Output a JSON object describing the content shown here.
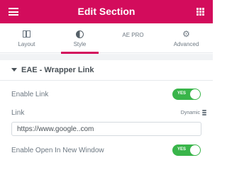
{
  "header": {
    "title": "Edit Section"
  },
  "tabs": [
    {
      "label": "Layout",
      "icon": "columns-icon"
    },
    {
      "label": "Style",
      "icon": "half-circle-icon",
      "active": true
    },
    {
      "label": "AE PRO"
    },
    {
      "label": "Advanced",
      "icon": "gear-icon"
    }
  ],
  "section": {
    "title": "EAE - Wrapper Link"
  },
  "controls": {
    "enable_link": {
      "label": "Enable Link",
      "toggle_text": "YES",
      "on": true
    },
    "link": {
      "label": "Link",
      "dynamic_label": "Dynamic",
      "value": "https://www.google..com"
    },
    "new_window": {
      "label": "Enable Open In New Window",
      "toggle_text": "YES",
      "on": true
    }
  },
  "colors": {
    "brand": "#d30c5c",
    "toggle_on": "#39b54a"
  }
}
